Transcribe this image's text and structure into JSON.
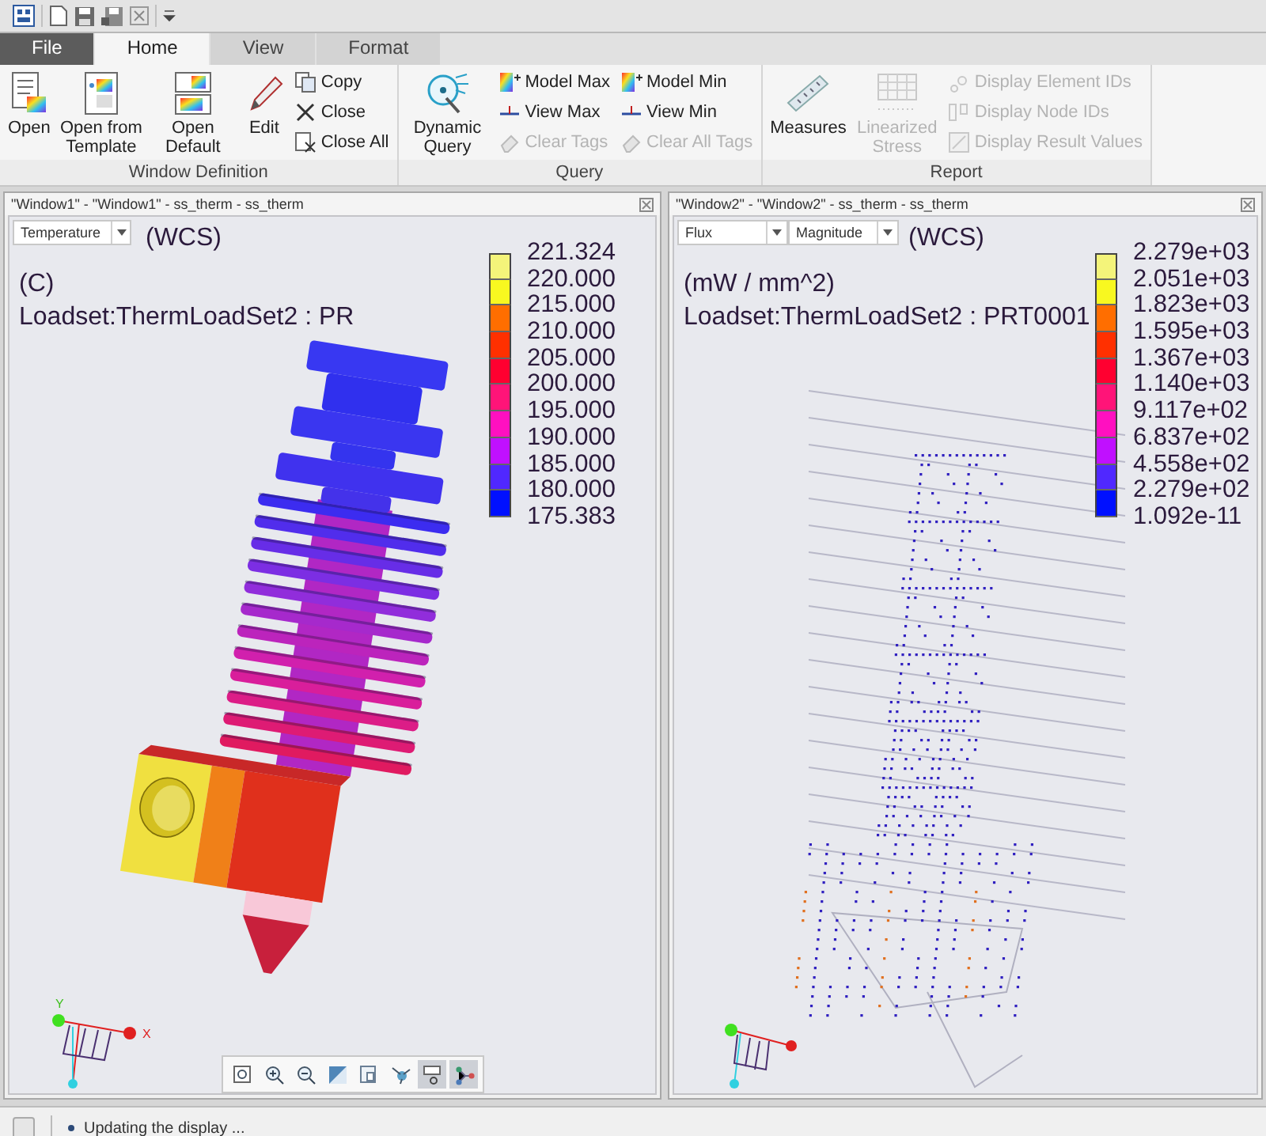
{
  "tabs": [
    {
      "label": "File",
      "kind": "file",
      "selected": false
    },
    {
      "label": "Home",
      "kind": "tab",
      "selected": true
    },
    {
      "label": "View",
      "kind": "tab",
      "selected": false
    },
    {
      "label": "Format",
      "kind": "tab",
      "selected": false
    }
  ],
  "ribbon": {
    "groups": [
      {
        "label": "Window Definition",
        "large": [
          {
            "label": "Open",
            "disabled": false
          },
          {
            "label": "Open from Template",
            "disabled": false
          },
          {
            "label": "Open Default",
            "disabled": false
          },
          {
            "label": "Edit",
            "disabled": false
          }
        ],
        "columns": [
          [
            {
              "label": "Copy",
              "disabled": false
            },
            {
              "label": "Close",
              "disabled": false
            },
            {
              "label": "Close All",
              "disabled": false
            }
          ]
        ]
      },
      {
        "label": "Query",
        "large": [
          {
            "label": "Dynamic Query",
            "disabled": false
          }
        ],
        "columns": [
          [
            {
              "label": "Model Max",
              "disabled": false
            },
            {
              "label": "View Max",
              "disabled": false
            },
            {
              "label": "Clear Tags",
              "disabled": true
            }
          ],
          [
            {
              "label": "Model Min",
              "disabled": false
            },
            {
              "label": "View Min",
              "disabled": false
            },
            {
              "label": "Clear All Tags",
              "disabled": true
            }
          ]
        ]
      },
      {
        "label": "Report",
        "large": [
          {
            "label": "Measures",
            "disabled": false
          },
          {
            "label": "Linearized Stress",
            "disabled": true
          }
        ],
        "columns": [
          [
            {
              "label": "Display Element IDs",
              "disabled": true
            },
            {
              "label": "Display Node IDs",
              "disabled": true
            },
            {
              "label": "Display Result Values",
              "disabled": true
            }
          ]
        ]
      }
    ]
  },
  "windows": [
    {
      "title": "\"Window1\" - \"Window1\" - ss_therm - ss_therm",
      "kind": "shaded",
      "selectors": [
        {
          "label": "Temperature"
        }
      ],
      "coord_system": "(WCS)",
      "unit": "(C)",
      "loadset": "Loadset:ThermLoadSet2 :  PR",
      "legend": {
        "labels": [
          "221.324",
          "220.000",
          "215.000",
          "210.000",
          "205.000",
          "200.000",
          "195.000",
          "190.000",
          "185.000",
          "180.000",
          "175.383"
        ],
        "bands": [
          {
            "color": "#f4f47a"
          },
          {
            "color": "#f8f820"
          },
          {
            "color": "#ff6e00"
          },
          {
            "color": "#ff3000"
          },
          {
            "color": "#ff0030"
          },
          {
            "color": "#ff1478"
          },
          {
            "color": "#ff10c0"
          },
          {
            "color": "#c010ff"
          },
          {
            "color": "#5028ff"
          },
          {
            "color": "#0010ff"
          }
        ]
      },
      "triad_labels": [
        "Y",
        "X"
      ],
      "view_toolbar": [
        {
          "kind": "zoom-window",
          "pressed": false
        },
        {
          "kind": "zoom-in",
          "pressed": false
        },
        {
          "kind": "zoom-out",
          "pressed": false
        },
        {
          "kind": "refit",
          "pressed": false
        },
        {
          "kind": "orient",
          "pressed": false
        },
        {
          "kind": "spin",
          "pressed": false
        },
        {
          "kind": "display",
          "pressed": true
        },
        {
          "kind": "nodes",
          "pressed": true
        }
      ]
    },
    {
      "title": "\"Window2\" - \"Window2\" - ss_therm - ss_therm",
      "kind": "vectors",
      "selectors": [
        {
          "label": "Flux"
        },
        {
          "label": "Magnitude"
        }
      ],
      "coord_system": "(WCS)",
      "unit": "(mW / mm^2)",
      "loadset": "Loadset:ThermLoadSet2 :  PRT0001",
      "legend": {
        "labels": [
          "2.279e+03",
          "2.051e+03",
          "1.823e+03",
          "1.595e+03",
          "1.367e+03",
          "1.140e+03",
          "9.117e+02",
          "6.837e+02",
          "4.558e+02",
          "2.279e+02",
          "1.092e-11"
        ],
        "bands": [
          {
            "color": "#f4f47a"
          },
          {
            "color": "#f8f820"
          },
          {
            "color": "#ff6e00"
          },
          {
            "color": "#ff3000"
          },
          {
            "color": "#ff0030"
          },
          {
            "color": "#ff1478"
          },
          {
            "color": "#ff10c0"
          },
          {
            "color": "#c010ff"
          },
          {
            "color": "#5028ff"
          },
          {
            "color": "#0010ff"
          }
        ]
      }
    }
  ],
  "status_bar": {
    "message": "Updating the display ..."
  }
}
